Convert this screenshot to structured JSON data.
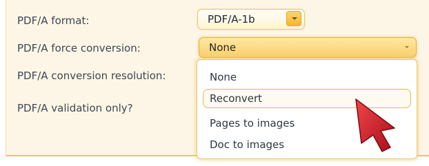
{
  "form": {
    "format_label": "PDF/A format:",
    "format_value": "PDF/A-1b",
    "force_label": "PDF/A force conversion:",
    "force_value": "None",
    "resolution_label": "PDF/A conversion resolution:",
    "validation_label": "PDF/A validation only?"
  },
  "dropdown": {
    "options": [
      "None",
      "Reconvert",
      "Pages to images",
      "Doc to images"
    ],
    "hovered_option": "Reconvert"
  },
  "colors": {
    "panel_background": "#fdf6e7",
    "accent": "#f4b631",
    "cursor": "#d8202a"
  },
  "icons": {
    "cursor": "mouse-pointer-icon"
  }
}
